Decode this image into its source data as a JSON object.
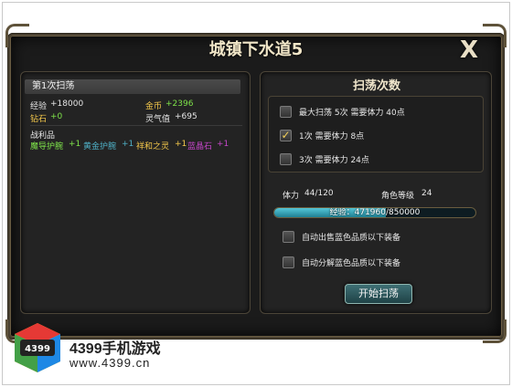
{
  "dialog": {
    "title": "城镇下水道5",
    "close_label": "X"
  },
  "result": {
    "header": "第1次扫荡",
    "exp_label": "经验",
    "exp_value": "+18000",
    "gold_label": "金币",
    "gold_value": "+2396",
    "diamond_label": "钻石",
    "diamond_value": "+0",
    "aura_label": "灵气值",
    "aura_value": "+695",
    "loot_label": "战利品",
    "loot": [
      {
        "name": "魔导护腕",
        "qty": "+1",
        "color": "#7ee24a"
      },
      {
        "name": "黄金护腕",
        "qty": "+1",
        "color": "#4fb0c6"
      },
      {
        "name": "祥和之灵",
        "qty": "+1",
        "color": "#f4c84b"
      },
      {
        "name": "蓝晶石",
        "qty": "+1",
        "color": "#c546c9"
      }
    ]
  },
  "sweep": {
    "title": "扫荡次数",
    "options": [
      {
        "label": "最大扫荡 5次 需要体力 40点",
        "checked": false
      },
      {
        "label": "1次 需要体力 8点",
        "checked": true
      },
      {
        "label": "3次 需要体力 24点",
        "checked": false
      }
    ],
    "stamina_label": "体力",
    "stamina_value": "44/120",
    "level_label": "角色等级",
    "level_value": "24",
    "exp_bar_label": "经验：",
    "exp_bar_value": "471960/850000",
    "exp_progress": 0.555,
    "auto_sell_label": "自动出售蓝色品质以下装备",
    "auto_decompose_label": "自动分解蓝色品质以下装备",
    "start_button": "开始扫荡"
  },
  "watermark": {
    "brand": "4399手机游戏",
    "url": "www.4399.cn",
    "logo_text": "4399"
  },
  "colors": {
    "accent_green": "#7ee24a",
    "accent_gold": "#f4c84b",
    "exp_fill": "#2a9bb0",
    "button_teal": "#2f5a5e"
  }
}
